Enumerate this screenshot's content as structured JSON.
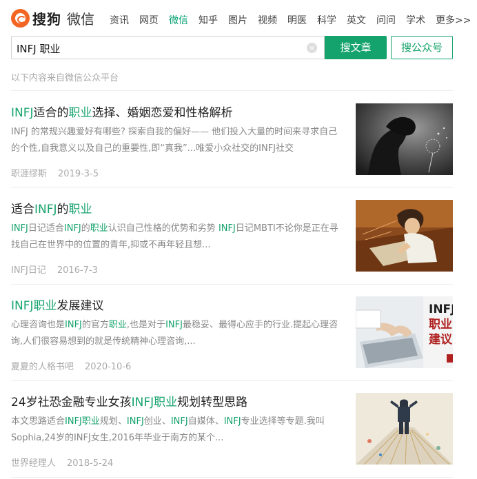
{
  "header": {
    "logo_text": "搜狗",
    "logo_sub": "微信",
    "nav": [
      {
        "label": "资讯",
        "active": false
      },
      {
        "label": "网页",
        "active": false
      },
      {
        "label": "微信",
        "active": true
      },
      {
        "label": "知乎",
        "active": false
      },
      {
        "label": "图片",
        "active": false
      },
      {
        "label": "视频",
        "active": false
      },
      {
        "label": "明医",
        "active": false
      },
      {
        "label": "科学",
        "active": false
      },
      {
        "label": "英文",
        "active": false
      },
      {
        "label": "问问",
        "active": false
      },
      {
        "label": "学术",
        "active": false
      },
      {
        "label": "更多>>",
        "active": false
      }
    ]
  },
  "search": {
    "query": "INFJ 职业",
    "clear_icon": "×",
    "search_article_label": "搜文章",
    "search_account_label": "搜公众号"
  },
  "source_note": "以下内容来自微信公众平台",
  "colors": {
    "accent": "#15a36d",
    "brand_orange": "#f26522",
    "muted": "#aaaaaa"
  },
  "results": [
    {
      "title": [
        {
          "text": "INFJ",
          "hl": true
        },
        {
          "text": "适合的",
          "hl": false
        },
        {
          "text": "职业",
          "hl": true
        },
        {
          "text": "选择、婚姻恋爱和性格解析",
          "hl": false
        }
      ],
      "summary": [
        {
          "text": "INFJ 的常规兴趣爱好有哪些? 探索自我的偏好—— 他们投入大量的时间来寻求自己的个性,自我意义以及自己的重要性,即“真我”...唯爱小众社交的INFJ社交",
          "hl": false
        }
      ],
      "account": "职涯缪斯",
      "date": "2019-3-5",
      "thumb": "bw-girl-dandelion-photo"
    },
    {
      "title": [
        {
          "text": "适合",
          "hl": false
        },
        {
          "text": "INFJ",
          "hl": true
        },
        {
          "text": "的",
          "hl": false
        },
        {
          "text": "职业",
          "hl": true
        }
      ],
      "summary": [
        {
          "text": "INFJ",
          "hl": true
        },
        {
          "text": "日记适合",
          "hl": false
        },
        {
          "text": "INFJ",
          "hl": true
        },
        {
          "text": "的",
          "hl": false
        },
        {
          "text": "职业",
          "hl": true
        },
        {
          "text": "认识自己性格的优势和劣势 ",
          "hl": false
        },
        {
          "text": "INFJ",
          "hl": true
        },
        {
          "text": "日记MBTI不论你是正在寻找自己在世界中的位置的青年,抑或不再年轻且想...",
          "hl": false
        }
      ],
      "account": "INFJ日记",
      "date": "2016-7-3",
      "thumb": "anime-man-drawing-illustration"
    },
    {
      "title": [
        {
          "text": "INFJ",
          "hl": true
        },
        {
          "text": "职业",
          "hl": true
        },
        {
          "text": "发展建议",
          "hl": false
        }
      ],
      "summary": [
        {
          "text": "心理咨询也是",
          "hl": false
        },
        {
          "text": "INFJ",
          "hl": true
        },
        {
          "text": "的官方",
          "hl": false
        },
        {
          "text": "职业",
          "hl": true
        },
        {
          "text": ",也是对于",
          "hl": false
        },
        {
          "text": "INFJ",
          "hl": true
        },
        {
          "text": "最稳妥、最得心应手的行业.提起心理咨询,人们很容易想到的就是传统精神心理咨询,...",
          "hl": false
        }
      ],
      "account": "夏夏的人格书吧",
      "date": "2020-10-6",
      "thumb": "laptop-hands-infj-career-banner",
      "thumb_text": [
        "INFJ",
        "职业",
        "建议"
      ]
    },
    {
      "title": [
        {
          "text": "24岁社恐金融专业女孩",
          "hl": false
        },
        {
          "text": "INFJ",
          "hl": true
        },
        {
          "text": "职业",
          "hl": true
        },
        {
          "text": "规划转型思路",
          "hl": false
        }
      ],
      "summary": [
        {
          "text": "本文思路适合",
          "hl": false
        },
        {
          "text": "INFJ",
          "hl": true
        },
        {
          "text": "职业",
          "hl": true
        },
        {
          "text": "规划、",
          "hl": false
        },
        {
          "text": "INFJ",
          "hl": true
        },
        {
          "text": "创业、",
          "hl": false
        },
        {
          "text": "INFJ",
          "hl": true
        },
        {
          "text": "自媒体、",
          "hl": false
        },
        {
          "text": "INFJ",
          "hl": true
        },
        {
          "text": "专业选择等专题.我叫Sophia,24岁的INFJ女生,2016年毕业于南方的某个...",
          "hl": false
        }
      ],
      "account": "世界经理人",
      "date": "2018-5-24",
      "thumb": "businessman-crossroads-illustration"
    }
  ]
}
